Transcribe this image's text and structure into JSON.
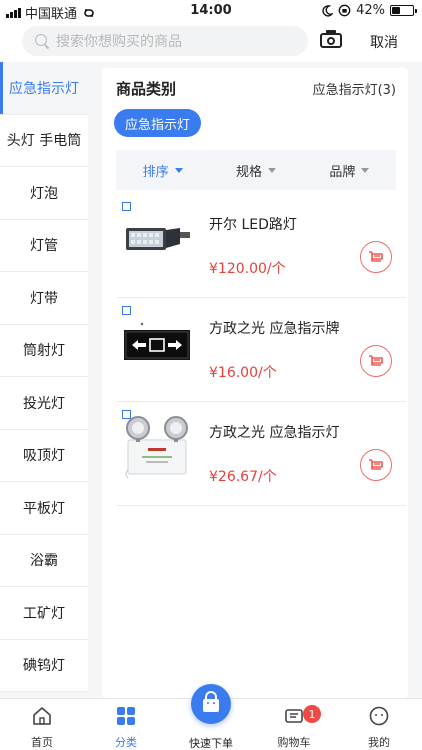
{
  "status_bar": {
    "carrier": "中国联通",
    "time": "14:00",
    "battery_percent": "42%",
    "battery_level": 0.42
  },
  "search": {
    "placeholder": "搜索你想购买的商品",
    "cancel_label": "取消"
  },
  "sidebar": {
    "items": [
      {
        "label": "应急指示灯",
        "active": true
      },
      {
        "label": "头灯 手电筒"
      },
      {
        "label": "灯泡"
      },
      {
        "label": "灯管"
      },
      {
        "label": "灯带"
      },
      {
        "label": "筒射灯"
      },
      {
        "label": "投光灯"
      },
      {
        "label": "吸顶灯"
      },
      {
        "label": "平板灯"
      },
      {
        "label": "浴霸"
      },
      {
        "label": "工矿灯"
      },
      {
        "label": "碘钨灯"
      }
    ]
  },
  "main": {
    "title": "商品类别",
    "current_category": "应急指示灯(3)",
    "selected_pill": "应急指示灯",
    "sort": {
      "sort_label": "排序",
      "spec_label": "规格",
      "brand_label": "品牌"
    },
    "products": [
      {
        "name": "开尔 LED路灯",
        "price": "¥120.00/个"
      },
      {
        "name": "方政之光 应急指示牌",
        "price": "¥16.00/个"
      },
      {
        "name": "方政之光 应急指示灯",
        "price": "¥26.67/个"
      }
    ]
  },
  "bottom_nav": {
    "home": "首页",
    "category": "分类",
    "quick_order": "快速下单",
    "cart": "购物车",
    "cart_count": "1",
    "mine": "我的"
  },
  "colors": {
    "accent": "#3a7bf0",
    "price": "#e5403a",
    "badge": "#f04a44"
  }
}
